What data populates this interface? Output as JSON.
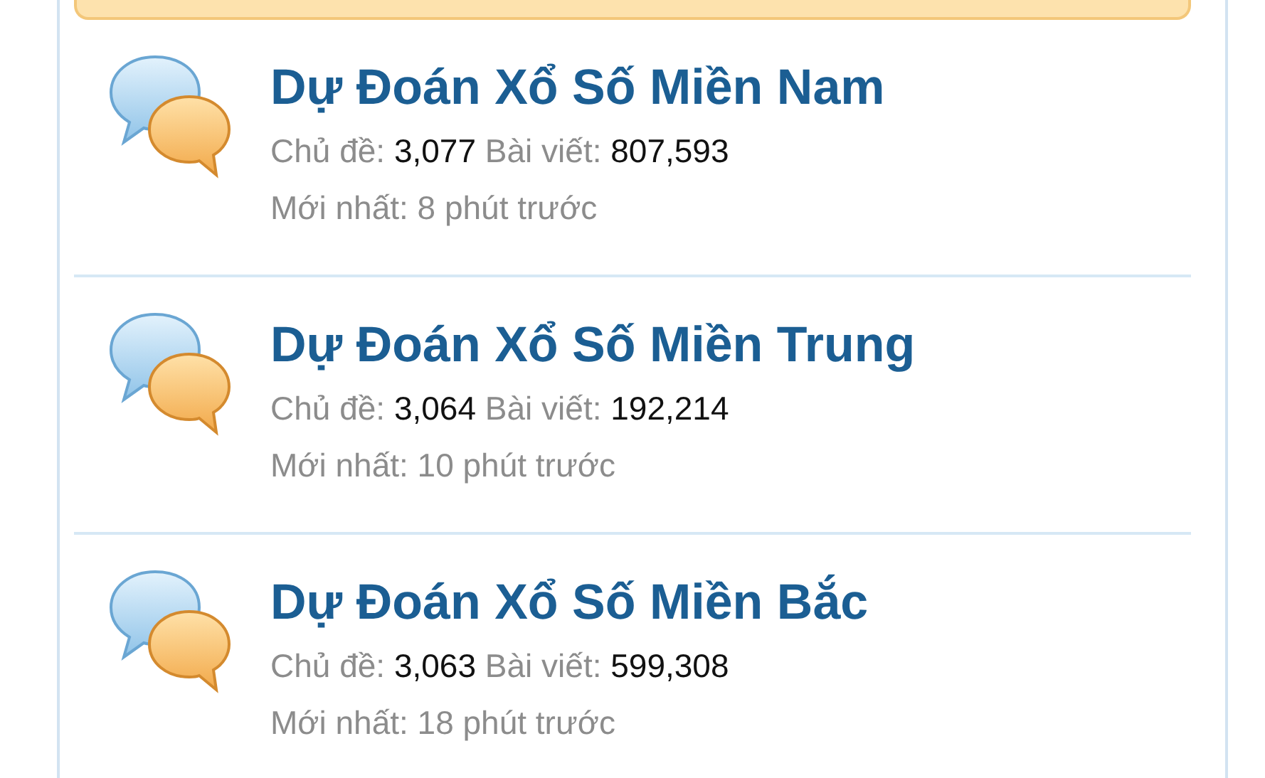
{
  "forums": [
    {
      "title": "Dự Đoán Xổ Số Miền Nam",
      "topics_label": "Chủ đề:",
      "topics": "3,077",
      "posts_label": "Bài viết:",
      "posts": "807,593",
      "latest": "Mới nhất: 8 phút trước"
    },
    {
      "title": "Dự Đoán Xổ Số Miền Trung",
      "topics_label": "Chủ đề:",
      "topics": "3,064",
      "posts_label": "Bài viết:",
      "posts": "192,214",
      "latest": "Mới nhất: 10 phút trước"
    },
    {
      "title": "Dự Đoán Xổ Số Miền Bắc",
      "topics_label": "Chủ đề:",
      "topics": "3,063",
      "posts_label": "Bài viết:",
      "posts": "599,308",
      "latest": "Mới nhất: 18 phút trước"
    }
  ]
}
